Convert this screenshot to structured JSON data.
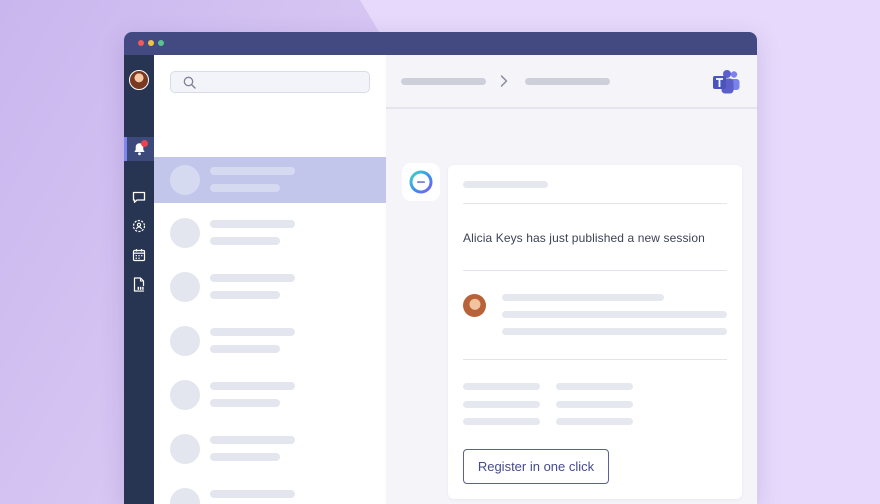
{
  "colors": {
    "titlebar": "#434981",
    "rail": "#283552",
    "selected_item": "#c1c6ea",
    "accent": "#464b8c",
    "badge": "#e8454e",
    "teams": "#5b5fc7"
  },
  "window": {
    "controls": [
      "close",
      "minimize",
      "maximize"
    ]
  },
  "rail": {
    "items": [
      {
        "icon": "bell-icon",
        "active": true,
        "has_badge": true
      },
      {
        "icon": "chat-icon",
        "active": false
      },
      {
        "icon": "team-icon",
        "active": false
      },
      {
        "icon": "calendar-icon",
        "active": false
      },
      {
        "icon": "document-icon",
        "active": false
      }
    ]
  },
  "search": {
    "placeholder": ""
  },
  "header": {
    "app_icon": "teams-icon"
  },
  "card": {
    "bot_icon": "brand-logo-icon",
    "message": "Alicia Keys has just published a new session",
    "register_label": "Register in one click"
  }
}
